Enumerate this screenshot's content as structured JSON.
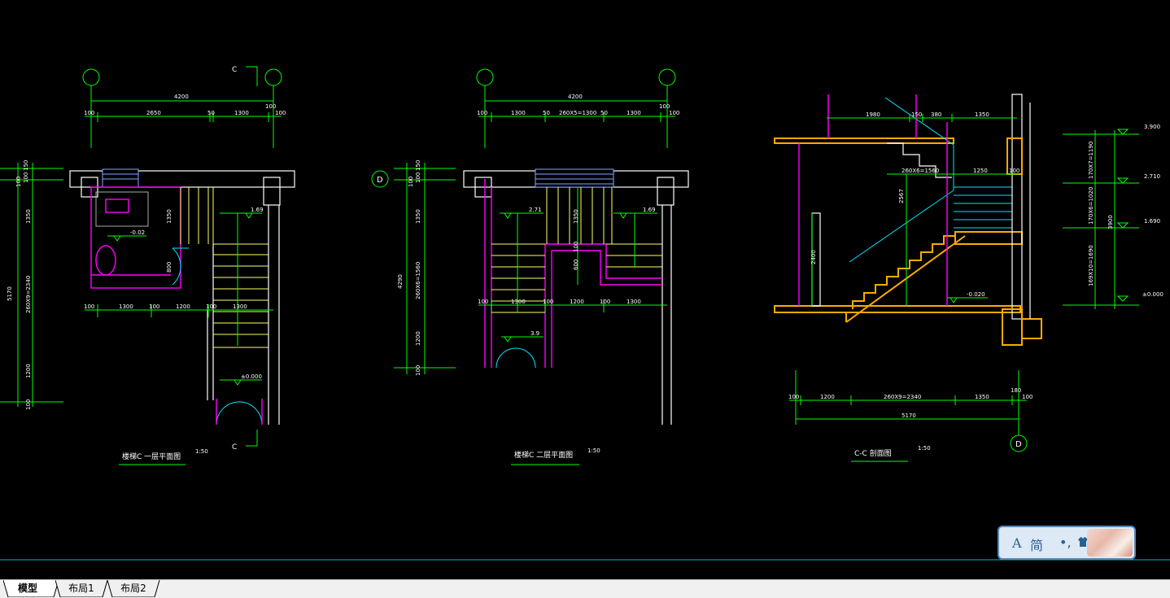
{
  "drawing": {
    "plan1": {
      "title": "楼梯C  一层平面图",
      "scale": "1:50",
      "grid_top_left": "",
      "grid_top_right": "",
      "section_mark_top": "C",
      "section_mark_bottom": "C",
      "dim_total": "4200",
      "dims_top": [
        "100",
        "2650",
        "50",
        "1300",
        "100",
        "100"
      ],
      "dims_mid": [
        "100",
        "1300",
        "100",
        "1200",
        "100",
        "1300"
      ],
      "dims_left": [
        "100",
        "150",
        "100",
        "1350",
        "260X9=2340",
        "1200",
        "100"
      ],
      "dim_left_total": "5170",
      "level_1": "-0.02",
      "level_2": "1.69",
      "level_3": "±0.000",
      "dim_1350": "1350",
      "dim_800": "800"
    },
    "plan2": {
      "title": "楼梯C  二层平面图",
      "scale": "1:50",
      "grid_left": "D",
      "dim_total": "4200",
      "dims_top": [
        "100",
        "1300",
        "50",
        "260X5=1300",
        "50",
        "1300",
        "100",
        "100"
      ],
      "dims_mid": [
        "100",
        "1300",
        "100",
        "1200",
        "100",
        "1300"
      ],
      "dims_left": [
        "100",
        "150",
        "100",
        "1350",
        "260X6=1560",
        "1200",
        "100"
      ],
      "dim_left_total": "4290",
      "level_1": "2.71",
      "level_2": "1.69",
      "level_3": "3.9",
      "dim_1350": "1350",
      "dim_100": "100",
      "dim_600": "600"
    },
    "section": {
      "title": "C-C  剖面图",
      "scale": "1:50",
      "grid_bottom": "D",
      "dims_top": [
        "1980",
        "150",
        "380",
        "1350"
      ],
      "dim_flight_upper": "260X6=1560",
      "dim_1250": "1250",
      "dim_100": "100",
      "dim_2567": "2567",
      "dim_2400": "2400",
      "level_lower": "-0.020",
      "dims_bottom": [
        "100",
        "1200",
        "260X9=2340",
        "1350",
        "180",
        "100"
      ],
      "dim_bottom_total": "5170",
      "right_levels": [
        "3.900",
        "2.710",
        "1.690",
        "±0.000"
      ],
      "right_dims": [
        "170X7=1190",
        "170X6=1020",
        "169X10=1690"
      ],
      "right_total": "3900"
    }
  },
  "tabs": [
    {
      "label": "模型",
      "active": true
    },
    {
      "label": "布局1",
      "active": false
    },
    {
      "label": "布局2",
      "active": false
    }
  ],
  "ime": {
    "mode": "A",
    "lang": "简",
    "punct": "•,"
  },
  "colors": {
    "background": "#000000",
    "dimension": "#00ff00",
    "wall": "#ffffff",
    "stair": "#ffff66",
    "fixture": "#ff00ff",
    "glass": "#00e5ff",
    "section_fill": "#ffaa00"
  }
}
